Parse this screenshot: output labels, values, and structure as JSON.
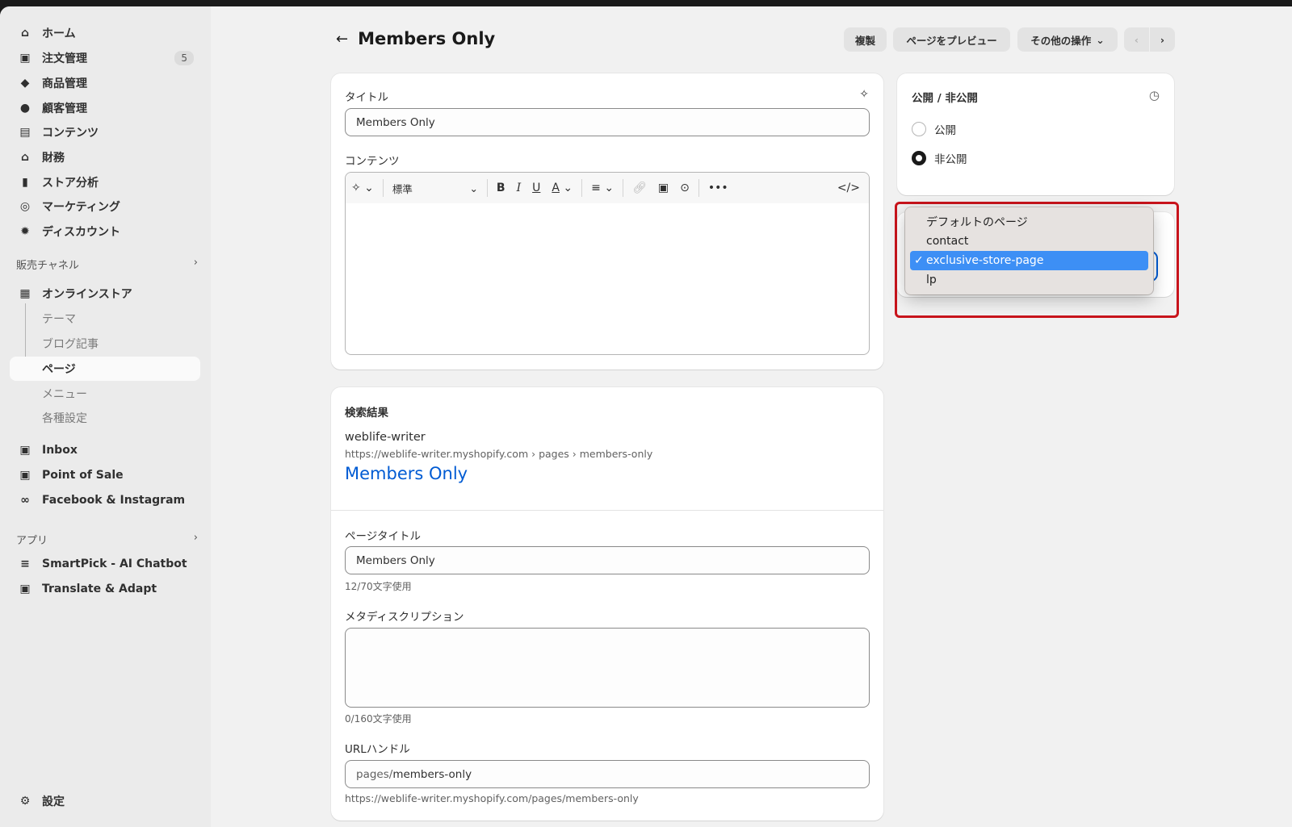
{
  "sidebar": {
    "items": [
      {
        "label": "ホーム",
        "icon": "home-icon"
      },
      {
        "label": "注文管理",
        "icon": "inbox-icon",
        "badge": "5"
      },
      {
        "label": "商品管理",
        "icon": "tag-icon"
      },
      {
        "label": "顧客管理",
        "icon": "person-icon"
      },
      {
        "label": "コンテンツ",
        "icon": "image-icon"
      },
      {
        "label": "財務",
        "icon": "bank-icon"
      },
      {
        "label": "ストア分析",
        "icon": "bar-chart-icon"
      },
      {
        "label": "マーケティング",
        "icon": "target-icon"
      },
      {
        "label": "ディスカウント",
        "icon": "discount-icon"
      }
    ],
    "sales_channels_label": "販売チャネル",
    "online_store": "オンラインストア",
    "online_store_sub": [
      "テーマ",
      "ブログ記事",
      "ページ",
      "メニュー",
      "各種設定"
    ],
    "channels": [
      "Inbox",
      "Point of Sale",
      "Facebook & Instagram"
    ],
    "apps_label": "アプリ",
    "apps": [
      "SmartPick - AI Chatbot",
      "Translate & Adapt"
    ],
    "settings": "設定"
  },
  "header": {
    "title": "Members Only",
    "duplicate": "複製",
    "preview": "ページをプレビュー",
    "more_actions": "その他の操作"
  },
  "editor": {
    "title_label": "タイトル",
    "title_value": "Members Only",
    "content_label": "コンテンツ",
    "format_select": "標準"
  },
  "seo": {
    "heading": "検索結果",
    "store_name": "weblife-writer",
    "breadcrumb": "https://weblife-writer.myshopify.com › pages › members-only",
    "link_title": "Members Only",
    "page_title_label": "ページタイトル",
    "page_title_value": "Members Only",
    "page_title_count": "12/70文字使用",
    "meta_label": "メタディスクリプション",
    "meta_value": "",
    "meta_count": "0/160文字使用",
    "url_label": "URLハンドル",
    "url_prefix": "pages/",
    "url_value": "members-only",
    "url_full": "https://weblife-writer.myshopify.com/pages/members-only"
  },
  "visibility": {
    "heading": "公開 / 非公開",
    "options": [
      "公開",
      "非公開"
    ],
    "selected": "非公開"
  },
  "template_dropdown": {
    "options": [
      "デフォルトのページ",
      "contact",
      "exclusive-store-page",
      "lp"
    ],
    "selected": "exclusive-store-page",
    "check": "✓"
  },
  "colors": {
    "highlight": "#c8141c",
    "selected_option": "#3d8ff5",
    "link": "#005bd3"
  }
}
